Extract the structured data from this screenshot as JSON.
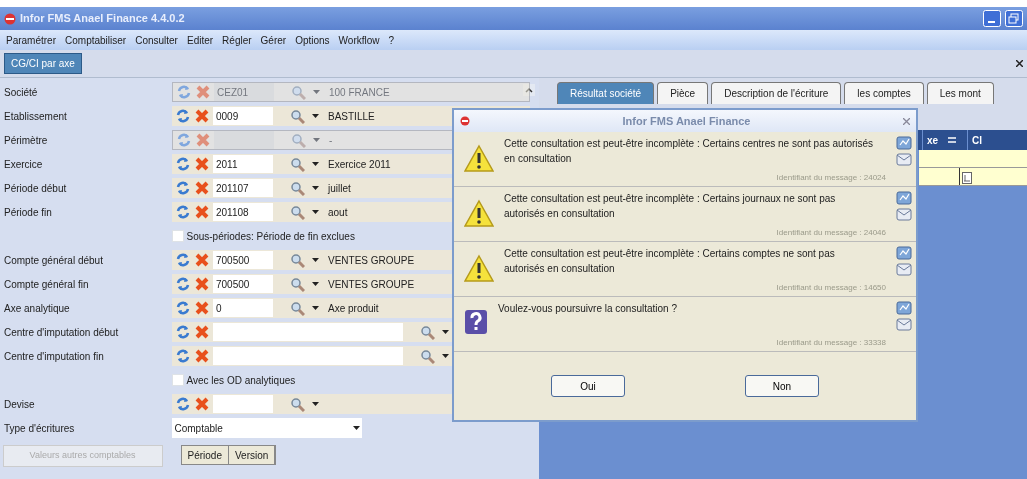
{
  "window": {
    "title": "Infor FMS Anael Finance 4.4.0.2"
  },
  "menu": [
    "Paramétrer",
    "Comptabiliser",
    "Consulter",
    "Editer",
    "Régler",
    "Gérer",
    "Options",
    "Workflow",
    "?"
  ],
  "view_tabs": [
    {
      "label": "CG/CI par axe",
      "selected": true
    }
  ],
  "form": {
    "rows": [
      {
        "kind": "lookup",
        "label": "Société",
        "code": "CEZ01",
        "description": "100 FRANCE",
        "disabled": true
      },
      {
        "kind": "lookup",
        "label": "Etablissement",
        "code": "0009",
        "description": "BASTILLE",
        "disabled": false
      },
      {
        "kind": "lookup",
        "label": "Périmètre",
        "description": "-",
        "disabled": true
      },
      {
        "kind": "lookup",
        "label": "Exercice",
        "code": "2011",
        "description": "Exercice 2011",
        "disabled": false
      },
      {
        "kind": "lookup",
        "label": "Période début",
        "code": "201107",
        "description": "juillet",
        "disabled": false
      },
      {
        "kind": "lookup",
        "label": "Période fin",
        "code": "201108",
        "description": "aout",
        "disabled": false
      },
      {
        "kind": "checkbox",
        "label": "Sous-périodes: Période de fin exclues",
        "checked": false
      },
      {
        "kind": "lookup",
        "label": "Compte général début",
        "code": "700500",
        "description": "VENTES GROUPE",
        "disabled": false
      },
      {
        "kind": "lookup",
        "label": "Compte général fin",
        "code": "700500",
        "description": "VENTES GROUPE",
        "disabled": false
      },
      {
        "kind": "lookup",
        "label": "Axe analytique",
        "code": "0",
        "description": "Axe produit",
        "disabled": false
      },
      {
        "kind": "lookup",
        "label": "Centre d'imputation début",
        "wide": true,
        "disabled": false
      },
      {
        "kind": "lookup",
        "label": "Centre d'imputation fin",
        "wide": true,
        "disabled": false
      },
      {
        "kind": "checkbox",
        "label": "Avec les OD analytiques",
        "checked": false
      },
      {
        "kind": "lookup",
        "label": "Devise",
        "disabled": false
      },
      {
        "kind": "select",
        "label": "Type d'écritures",
        "value": "Comptable"
      }
    ]
  },
  "side_button": {
    "label": "Valeurs autres comptables",
    "disabled": true
  },
  "period_table": {
    "columns": [
      "Période",
      "Version"
    ]
  },
  "result_tabs": [
    {
      "label": "Résultat société",
      "selected": true
    },
    {
      "label": "Pièce",
      "selected": false
    },
    {
      "label": "Description de l'écriture",
      "selected": false
    },
    {
      "label": "les comptes",
      "selected": false
    },
    {
      "label": "Les mont",
      "selected": false
    }
  ],
  "grid": {
    "columns": [
      "xe",
      "Cl"
    ]
  },
  "dialog": {
    "title": "Infor FMS Anael Finance",
    "messages": [
      {
        "kind": "warning",
        "text": "Cette consultation est peut-être incomplète : Certains centres ne sont pas autorisés en consultation",
        "id_label": "Identifiant du message : 24024"
      },
      {
        "kind": "warning",
        "text": "Cette consultation est peut-être incomplète : Certains journaux ne sont pas autorisés en consultation",
        "id_label": "Identifiant du message : 24046"
      },
      {
        "kind": "warning",
        "text": "Cette consultation est peut-être incomplète : Certains comptes ne sont pas autorisés en consultation",
        "id_label": "Identifiant du message : 14650"
      },
      {
        "kind": "question",
        "text": "Voulez-vous poursuivre la consultation ?",
        "id_label": "Identifiant du message : 33338"
      }
    ],
    "buttons": [
      "Oui",
      "Non"
    ]
  }
}
